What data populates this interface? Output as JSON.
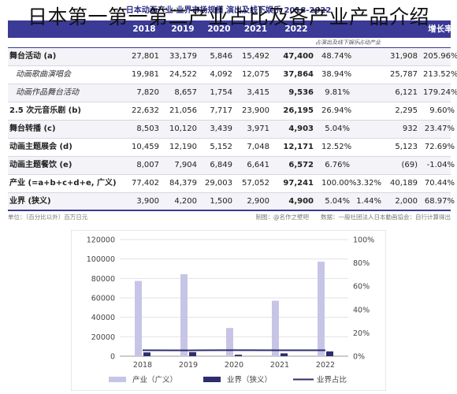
{
  "title": "日本第一第一第二产业占比及各产业产品介绍",
  "table_caption": "日本动画产业·业界市场规模 演出及线下娱乐 2018-2022",
  "columns": [
    "",
    "2018",
    "2019",
    "2020",
    "2021",
    "2022",
    "",
    "",
    "",
    "增长率"
  ],
  "sub_headers": [
    "",
    "",
    "",
    "",
    "",
    "",
    "占演出及线下娱乐",
    "占动产业",
    "",
    ""
  ],
  "rows": [
    {
      "label": "舞台活动 (a)",
      "sub": false,
      "shade": true,
      "v": [
        "27,801",
        "33,179",
        "5,846",
        "15,492",
        "47,400",
        "48.74%",
        "",
        "31,908",
        "205.96%"
      ]
    },
    {
      "label": "动画歌曲演唱会",
      "sub": true,
      "shade": false,
      "v": [
        "19,981",
        "24,522",
        "4,092",
        "12,075",
        "37,864",
        "38.94%",
        "",
        "25,787",
        "213.52%"
      ]
    },
    {
      "label": "动画作品舞台活动",
      "sub": true,
      "shade": true,
      "v": [
        "7,820",
        "8,657",
        "1,754",
        "3,415",
        "9,536",
        "9.81%",
        "",
        "6,121",
        "179.24%"
      ]
    },
    {
      "label": "2.5 次元音乐剧 (b)",
      "sub": false,
      "shade": false,
      "v": [
        "22,632",
        "21,056",
        "7,717",
        "23,900",
        "26,195",
        "26.94%",
        "",
        "2,295",
        "9.60%"
      ]
    },
    {
      "label": "舞台转播 (c)",
      "sub": false,
      "shade": true,
      "v": [
        "8,503",
        "10,120",
        "3,439",
        "3,971",
        "4,903",
        "5.04%",
        "",
        "932",
        "23.47%"
      ]
    },
    {
      "label": "动画主题展会 (d)",
      "sub": false,
      "shade": false,
      "v": [
        "10,459",
        "12,190",
        "5,152",
        "7,048",
        "12,171",
        "12.52%",
        "",
        "5,123",
        "72.69%"
      ]
    },
    {
      "label": "动画主题餐饮 (e)",
      "sub": false,
      "shade": true,
      "v": [
        "8,007",
        "7,904",
        "6,849",
        "6,641",
        "6,572",
        "6.76%",
        "",
        "(69)",
        "-1.04%"
      ]
    },
    {
      "label": "产业 (=a+b+c+d+e, 广义)",
      "sub": false,
      "shade": false,
      "v": [
        "77,402",
        "84,379",
        "29,003",
        "57,052",
        "97,241",
        "100.00%",
        "3.32%",
        "40,189",
        "70.44%"
      ]
    },
    {
      "label": "业界 (狭义)",
      "sub": false,
      "shade": true,
      "v": [
        "3,900",
        "4,200",
        "1,500",
        "2,900",
        "4,900",
        "5.04%",
        "1.44%",
        "2,000",
        "68.97%"
      ]
    }
  ],
  "footnote_left": "单位：（百分比以外）百万日元",
  "footnote_right": "制图：@名作之壁吧　　数据：一般社团法人日本動画協会：自行计算得出",
  "colors": {
    "header": "#3b3a96",
    "bar_industry": "#c7c5e6",
    "bar_business": "#2e2d6e",
    "line_share": "#2e2d6e"
  },
  "chart_data": {
    "type": "bar",
    "categories": [
      "2018",
      "2019",
      "2020",
      "2021",
      "2022"
    ],
    "series": [
      {
        "name": "产业（广义）",
        "kind": "bar",
        "axis": "left",
        "values": [
          77402,
          84379,
          29003,
          57052,
          97241
        ]
      },
      {
        "name": "业界（狭义）",
        "kind": "bar",
        "axis": "left",
        "values": [
          3900,
          4200,
          1500,
          2900,
          4900
        ]
      },
      {
        "name": "业界占比",
        "kind": "line",
        "axis": "right",
        "values": [
          5.04,
          4.98,
          5.17,
          5.08,
          5.04
        ]
      }
    ],
    "ylim_left": [
      0,
      120000
    ],
    "yticks_left": [
      "0",
      "20000",
      "40000",
      "60000",
      "80000",
      "100000",
      "120000"
    ],
    "ylim_right": [
      0,
      100
    ],
    "yticks_right": [
      "0%",
      "20%",
      "40%",
      "60%",
      "80%",
      "100%"
    ],
    "legend_position": "bottom"
  }
}
